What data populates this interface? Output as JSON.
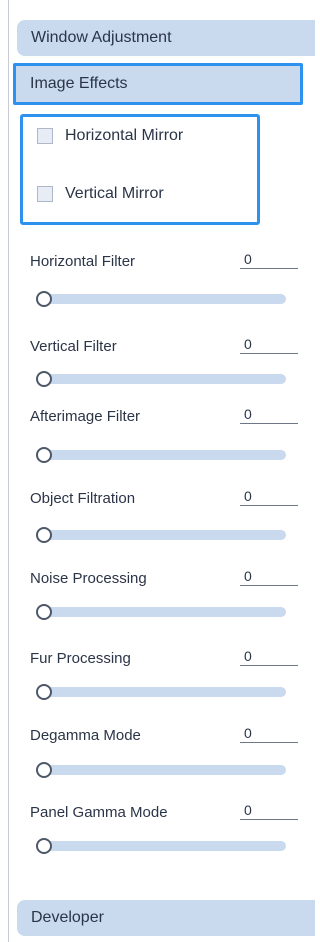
{
  "sections": {
    "window_adjustment": "Window Adjustment",
    "image_effects": "Image Effects",
    "developer": "Developer"
  },
  "image_effects": {
    "horizontal_mirror": {
      "label": "Horizontal Mirror",
      "checked": false
    },
    "vertical_mirror": {
      "label": "Vertical Mirror",
      "checked": false
    }
  },
  "filters": [
    {
      "label": "Horizontal Filter",
      "value": "0"
    },
    {
      "label": "Vertical Filter",
      "value": "0"
    },
    {
      "label": "Afterimage Filter",
      "value": "0"
    },
    {
      "label": "Object Filtration",
      "value": "0"
    },
    {
      "label": "Noise Processing",
      "value": "0"
    },
    {
      "label": "Fur Processing",
      "value": "0"
    },
    {
      "label": "Degamma Mode",
      "value": "0"
    },
    {
      "label": "Panel Gamma Mode",
      "value": "0"
    }
  ],
  "colors": {
    "highlight_border": "#2d91f0",
    "header_background": "#c9d9ee",
    "slider_track": "#c9d9ee"
  }
}
